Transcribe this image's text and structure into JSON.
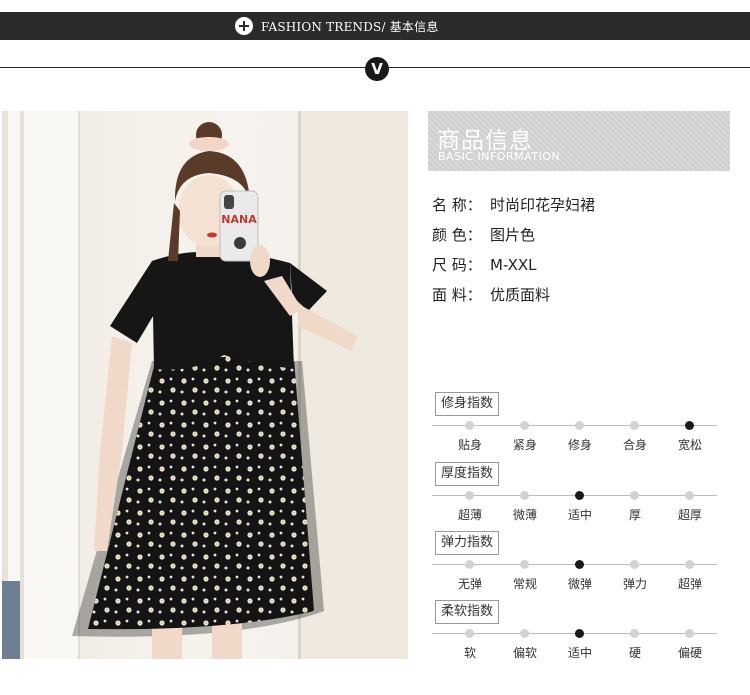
{
  "header": {
    "title": "FASHION TRENDS/ 基本信息",
    "badge": "V"
  },
  "info": {
    "title_cn": "商品信息",
    "title_en": "BASIC INFORMATION",
    "details": [
      {
        "key": "名 称：",
        "value": "时尚印花孕妇裙"
      },
      {
        "key": "颜 色：",
        "value": "图片色"
      },
      {
        "key": "尺 码：",
        "value": "M-XXL"
      },
      {
        "key": "面 料：",
        "value": "优质面料"
      }
    ]
  },
  "phone_case_text": "NANA",
  "indices": [
    {
      "name": "修身指数",
      "options": [
        "贴身",
        "紧身",
        "修身",
        "合身",
        "宽松"
      ],
      "selected_index": 4
    },
    {
      "name": "厚度指数",
      "options": [
        "超薄",
        "微薄",
        "适中",
        "厚",
        "超厚"
      ],
      "selected_index": 2
    },
    {
      "name": "弹力指数",
      "options": [
        "无弹",
        "常规",
        "微弹",
        "弹力",
        "超弹"
      ],
      "selected_index": 2
    },
    {
      "name": "柔软指数",
      "options": [
        "软",
        "偏软",
        "适中",
        "硬",
        "偏硬"
      ],
      "selected_index": 2
    }
  ],
  "colors": {
    "bar": "#2b2b2b",
    "dot_on": "#1a1a1a",
    "dot_off": "#d2d2d2"
  }
}
